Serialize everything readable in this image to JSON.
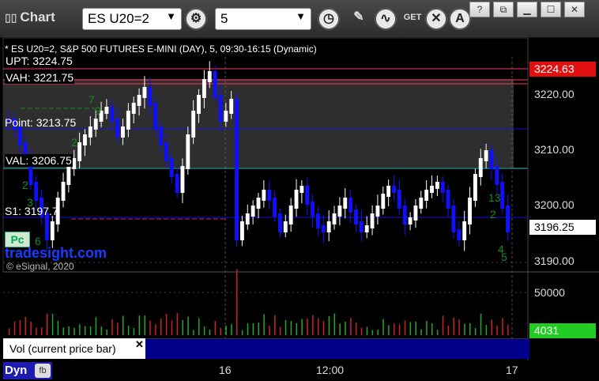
{
  "app": {
    "title": "Chart"
  },
  "toolbar": {
    "symbol": "ES U20=2",
    "interval": "5",
    "icons": [
      "gear-icon",
      "clock-icon",
      "pencil-icon",
      "indicator-icon",
      "get-icon",
      "close-circle-icon",
      "alert-icon"
    ]
  },
  "chart": {
    "header": "* ES U20=2, S&P 500 FUTURES E-MINI (DAY), 5, 09:30-16:15 (Dynamic)",
    "levels": {
      "upt": "UPT: 3224.75",
      "vah": "VAH: 3221.75",
      "poc": "Point: 3213.75",
      "val": "VAL: 3206.75",
      "s1": "S1: 3197.7"
    },
    "price_axis": [
      "3220.00",
      "3210.00",
      "3200.00",
      "3190.00"
    ],
    "price_high_tag": "3224.63",
    "price_last_tag": "3196.25",
    "volume_axis": "50000",
    "volume_last": "4031",
    "time_labels": [
      "16",
      "12:00",
      "17"
    ],
    "watermark": "tradesight.com",
    "copyright": "© eSignal, 2020",
    "pc_badge": "Pc",
    "annotations": [
      "7",
      "9",
      "2",
      "2",
      "3",
      "6",
      "13",
      "2",
      "4",
      "5"
    ]
  },
  "volume_panel": {
    "label": "Vol (current price bar)"
  },
  "status": {
    "mode": "Dyn"
  },
  "colors": {
    "up": "#ffffff",
    "down": "#1010ff",
    "upt_line": "#ff3355",
    "poc_line": "#0000cc",
    "val_line": "#40c0c0",
    "s1_line": "#cc2288",
    "price_tag_red": "#e01010",
    "price_tag_green": "#22cc22"
  }
}
